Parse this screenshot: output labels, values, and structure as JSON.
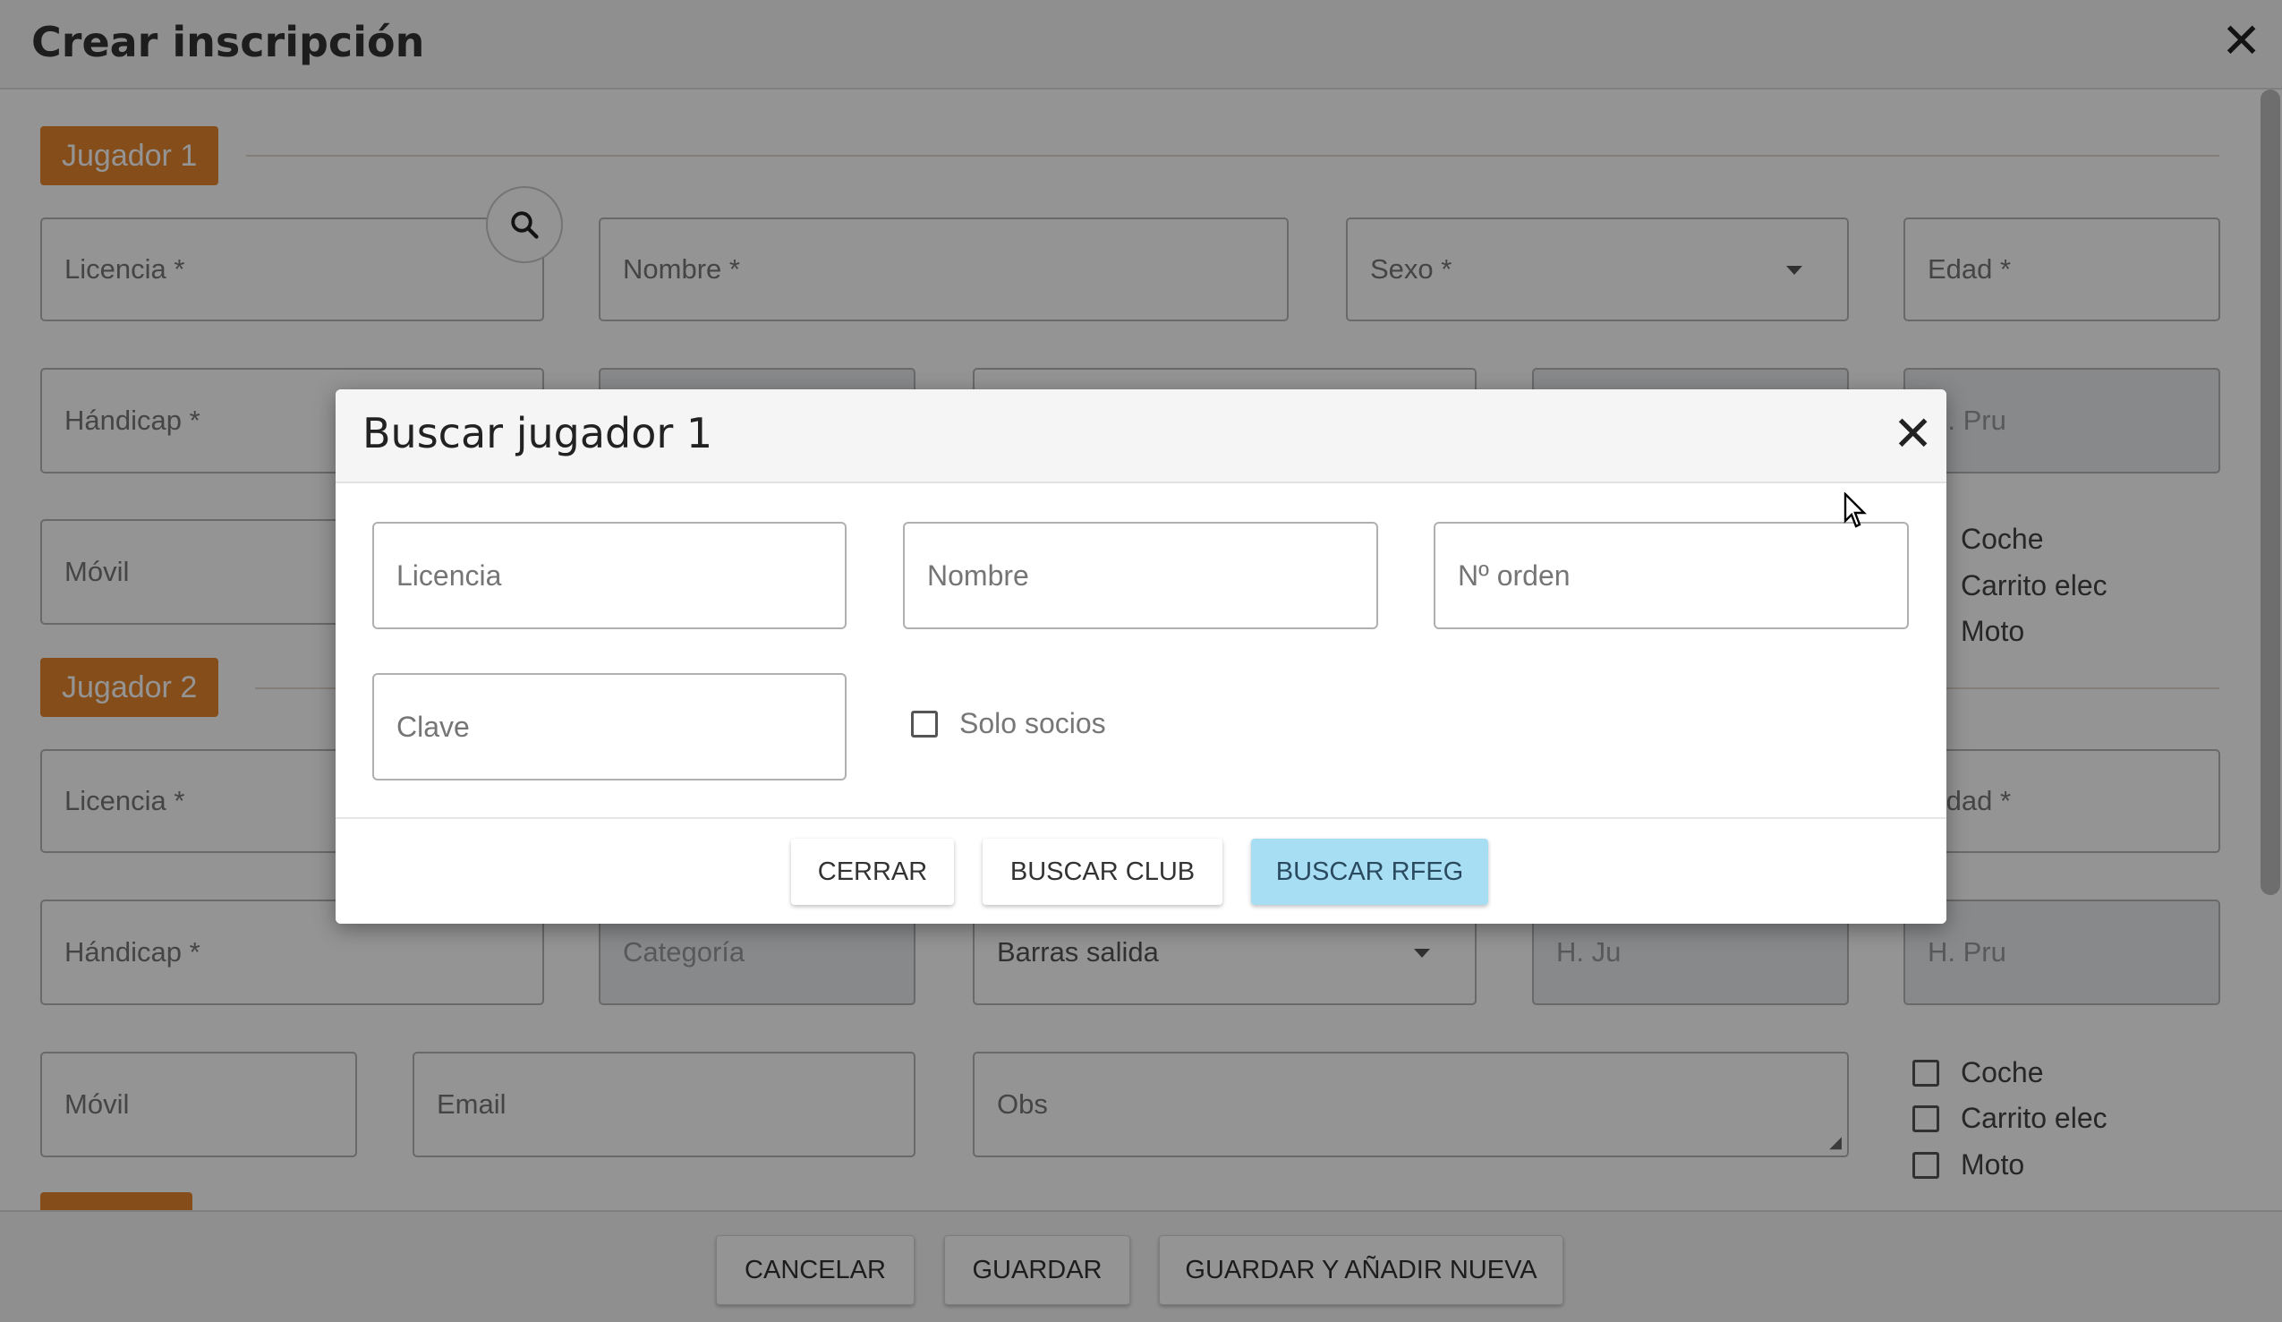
{
  "base_dialog": {
    "title": "Crear inscripción",
    "close_symbol": "✕",
    "jugador1": {
      "badge": "Jugador 1",
      "licencia": "Licencia *",
      "nombre": "Nombre *",
      "sexo": "Sexo *",
      "edad": "Edad *",
      "handicap": "Hándicap *",
      "hpru": "H. Pru",
      "movil": "Móvil",
      "coche": "Coche",
      "carrito": "Carrito elec",
      "moto": "Moto"
    },
    "jugador2": {
      "badge": "Jugador 2",
      "licencia": "Licencia *",
      "edad": "Edad *",
      "handicap": "Hándicap *",
      "categoria": "Categoría",
      "barras": "Barras salida",
      "hju": "H. Ju",
      "hpru": "H. Pru",
      "movil": "Móvil",
      "email": "Email",
      "obs": "Obs",
      "coche": "Coche",
      "carrito": "Carrito elec",
      "moto": "Moto"
    },
    "footer": {
      "cancelar": "CANCELAR",
      "guardar": "GUARDAR",
      "guardar_nueva": "GUARDAR Y AÑADIR NUEVA"
    }
  },
  "modal": {
    "title": "Buscar jugador 1",
    "close_symbol": "✕",
    "licencia_placeholder": "Licencia",
    "nombre_placeholder": "Nombre",
    "orden_placeholder": "Nº orden",
    "clave_placeholder": "Clave",
    "solo_socios": "Solo socios",
    "buttons": {
      "cerrar": "CERRAR",
      "buscar_club": "BUSCAR CLUB",
      "buscar_rfeg": "BUSCAR RFEG"
    }
  },
  "icons": {
    "search": "search-icon",
    "close": "close-icon",
    "cursor": "mouse-pointer-icon"
  },
  "colors": {
    "badge": "#e6862d",
    "primary_button": "#a8def3",
    "overlay": "rgba(0,0,0,0.42)"
  }
}
